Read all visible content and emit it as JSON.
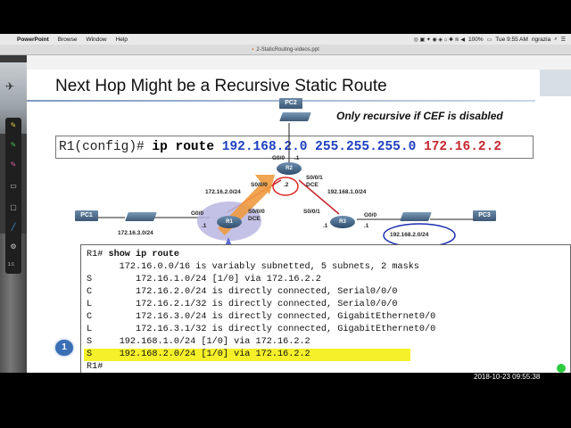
{
  "menubar": {
    "app": "PowerPoint",
    "items": [
      "Browse",
      "Window",
      "Help"
    ],
    "battery": "100%",
    "clock": "Tue 9:55 AM",
    "user": "rigrazia"
  },
  "window": {
    "title": "2-StaticRouting-videos.ppt"
  },
  "sidebar": {
    "page": "1:1"
  },
  "slide": {
    "title": "Next Hop Might be a Recursive Static Route",
    "note": "Only recursive if CEF is disabled",
    "command": {
      "prompt": "R1(config)# ",
      "keyword": "ip route",
      "network": "192.168.2.0",
      "mask": "255.255.255.0",
      "nexthop": "172.16.2.2"
    },
    "diagram": {
      "pc1": "PC1",
      "pc2": "PC2",
      "pc3": "PC3",
      "r1": "R1",
      "r2": "R2",
      "r3": "R3",
      "g00_r2": "G0/0",
      "dot1_r2": ".1",
      "s000_r2": "S0/0/0",
      "dot2_r2": ".2",
      "s001_r2": "S0/0/1",
      "dce_r2": "DCE",
      "net_r1r2": "172.16.2.0/24",
      "net_r2r3": "192.168.1.0/24",
      "g00_r1": "G0/0",
      "dot1_r1": ".1",
      "s000_r1": "S0/0/0",
      "dce_r1": "DCE",
      "net_lan1": "172.16.3.0/24",
      "s001_r3": "S0/0/1",
      "dot1_r3": ".1",
      "g00_r3": "G0/0",
      "dot1b_r3": ".1",
      "net_lan3": "192.168.2.0/24"
    },
    "routing_table": {
      "lines": [
        {
          "code": "R1# ",
          "text": "show ip route",
          "bold": true
        },
        {
          "code": "",
          "text": "      172.16.0.0/16 is variably subnetted, 5 subnets, 2 masks"
        },
        {
          "code": "S",
          "text": "        172.16.1.0/24 [1/0] via 172.16.2.2"
        },
        {
          "code": "C",
          "text": "        172.16.2.0/24 is directly connected, Serial0/0/0"
        },
        {
          "code": "L",
          "text": "        172.16.2.1/32 is directly connected, Serial0/0/0"
        },
        {
          "code": "C",
          "text": "        172.16.3.0/24 is directly connected, GigabitEthernet0/0"
        },
        {
          "code": "L",
          "text": "        172.16.3.1/32 is directly connected, GigabitEthernet0/0"
        },
        {
          "code": "S",
          "text": "     192.168.1.0/24 [1/0] via 172.16.2.2"
        },
        {
          "code": "S",
          "text": "     192.168.2.0/24 [1/0] via 172.16.2.2",
          "highlight": true
        },
        {
          "code": "R1#",
          "text": ""
        }
      ]
    },
    "step_badge": "1"
  },
  "recording_timestamp": "2018-10-23  09:55:38",
  "colors": {
    "highlight": "#f5f02a",
    "cmd_blue": "#1d3fbf",
    "cmd_red": "#c6262e",
    "link_red": "#c6262e",
    "circle_blue": "#1d2fb0"
  }
}
